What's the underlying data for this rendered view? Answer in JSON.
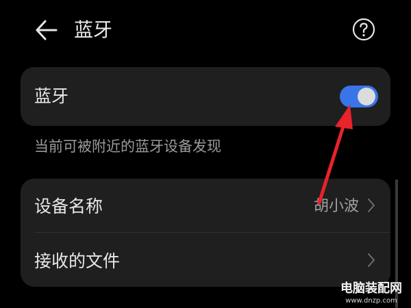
{
  "header": {
    "title": "蓝牙",
    "back_icon": "arrow-left-icon",
    "help_icon": "question-circle-icon"
  },
  "bluetooth": {
    "label": "蓝牙",
    "enabled": true,
    "note": "当前可被附近的蓝牙设备发现"
  },
  "settings": {
    "device_name": {
      "label": "设备名称",
      "value": "胡小波"
    },
    "received_files": {
      "label": "接收的文件"
    }
  },
  "watermark": {
    "title": "电脑装配网",
    "url": "www.dnzp.com"
  },
  "colors": {
    "background": "#000000",
    "card": "#1f1f1f",
    "toggle_on": "#3a74e8",
    "annotation_arrow": "#e8232a"
  }
}
